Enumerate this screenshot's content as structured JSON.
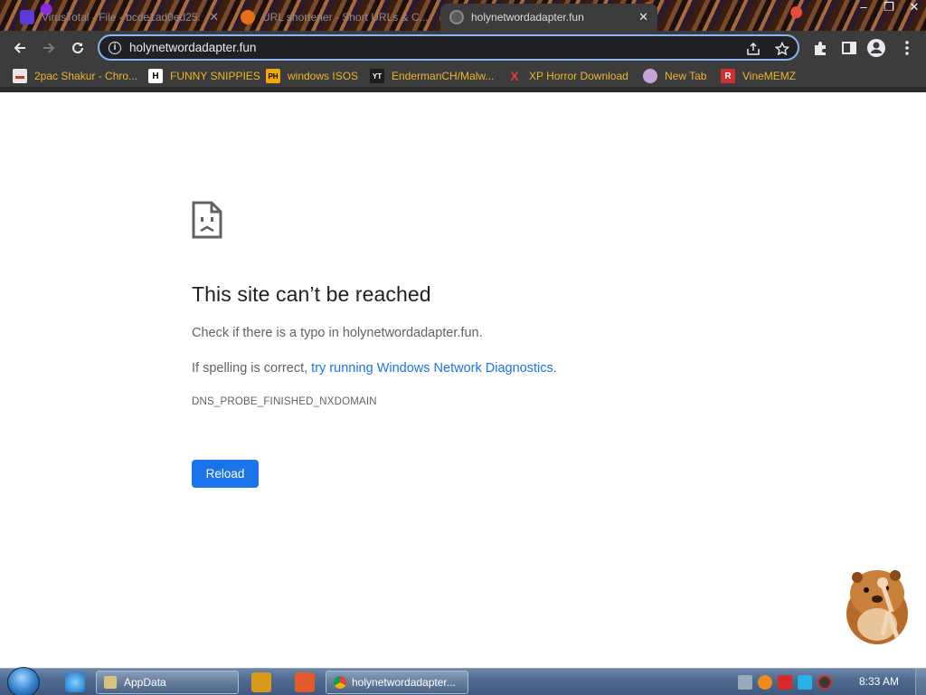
{
  "browser": {
    "tabs": [
      {
        "title": "VirusTotal - File - bcde1ad0ed25...",
        "active": false
      },
      {
        "title": "URL shortener - Short URLs & C...",
        "active": false
      },
      {
        "title": "holynetwordadapter.fun",
        "active": true
      }
    ],
    "address_bar": {
      "url": "holynetwordadapter.fun"
    },
    "bookmarks": [
      {
        "label": "2pac Shakur - Chro...",
        "icon": "bookmark-2pac-icon",
        "badge": ""
      },
      {
        "label": "FUNNY SNIPPIES",
        "icon": "bookmark-h-icon",
        "badge": "H"
      },
      {
        "label": "windows ISOS",
        "icon": "bookmark-ph-icon",
        "badge": "PH"
      },
      {
        "label": "EndermanCH/Malw...",
        "icon": "bookmark-yt-icon",
        "badge": "YT"
      },
      {
        "label": "XP Horror Download",
        "icon": "bookmark-x-icon",
        "badge": "X"
      },
      {
        "label": "New Tab",
        "icon": "bookmark-newtab-icon",
        "badge": ""
      },
      {
        "label": "VineMEMZ",
        "icon": "bookmark-r-icon",
        "badge": "R"
      }
    ]
  },
  "error_page": {
    "title": "This site can’t be reached",
    "line1": "Check if there is a typo in holynetwordadapter.fun.",
    "line2_prefix": "If spelling is correct, ",
    "line2_link": "try running Windows Network Diagnostics",
    "line2_suffix": ".",
    "error_code": "DNS_PROBE_FINISHED_NXDOMAIN",
    "reload_label": "Reload"
  },
  "taskbar": {
    "items": [
      {
        "label": "AppData",
        "icon": "folder-icon"
      },
      {
        "label": "holynetwordadapter...",
        "icon": "chrome-icon"
      }
    ],
    "clock": "8:33 AM"
  },
  "colors": {
    "link": "#1a73e8",
    "button": "#1a73e8",
    "bookmark_text": "#f0b429",
    "toolbar": "#3c3c3c"
  }
}
